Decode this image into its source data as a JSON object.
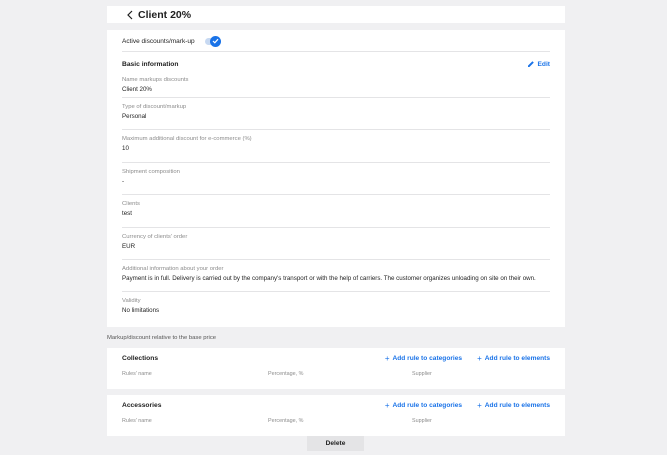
{
  "header": {
    "title": "Client 20%"
  },
  "active_toggle": {
    "label": "Active discounts/mark-up",
    "checked": true
  },
  "basic_info": {
    "title": "Basic information",
    "edit_label": "Edit",
    "fields": [
      {
        "label": "Name markups discounts",
        "value": "Client 20%"
      },
      {
        "label": "Type of discount/markup",
        "value": "Personal"
      },
      {
        "label": "Maximum additional discount for e-commerce (%)",
        "value": "10"
      },
      {
        "label": "Shipment composition",
        "value": "-"
      },
      {
        "label": "Clients",
        "value": "test"
      },
      {
        "label": "Currency of clients' order",
        "value": "EUR"
      },
      {
        "label": "Additional information about your order",
        "value": "Payment is in full. Delivery is carried out by the company's transport or with the help of carriers. The customer organizes unloading on site on their own."
      },
      {
        "label": "Validity",
        "value": "No limitations"
      }
    ]
  },
  "markup_section": {
    "caption": "Markup/discount relative to the base price",
    "add_categories_label": "Add rule to categories",
    "add_elements_label": "Add rule to elements",
    "columns": [
      "Rules' name",
      "Percentage, %",
      "Supplier"
    ],
    "groups": [
      {
        "title": "Collections"
      },
      {
        "title": "Accessories"
      }
    ]
  },
  "delete_label": "Delete",
  "colors": {
    "accent": "#1a73e8",
    "background": "#f0f0f2",
    "card": "#ffffff"
  }
}
